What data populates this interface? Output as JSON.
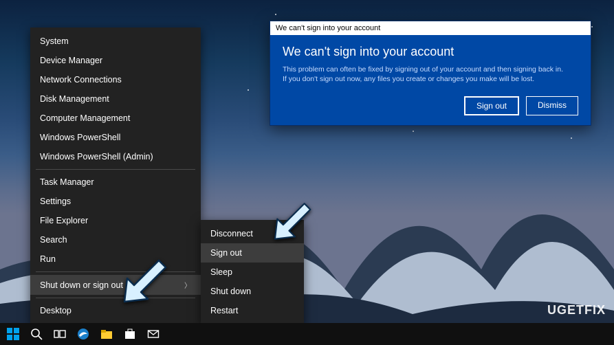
{
  "dialog": {
    "titlebar": "We can't sign into your account",
    "headline": "We can't sign into your account",
    "msg_line1": "This problem can often be fixed by signing out of your account and then signing back in.",
    "msg_line2": "If you don't sign out now, any files you create or changes you make will be lost.",
    "signout_label": "Sign out",
    "dismiss_label": "Dismiss"
  },
  "winx": {
    "items_group1": [
      "System",
      "Device Manager",
      "Network Connections",
      "Disk Management",
      "Computer Management",
      "Windows PowerShell",
      "Windows PowerShell (Admin)"
    ],
    "items_group2": [
      "Task Manager",
      "Settings",
      "File Explorer",
      "Search",
      "Run"
    ],
    "shutdown_label": "Shut down or sign out",
    "desktop_label": "Desktop"
  },
  "submenu": {
    "items": [
      "Disconnect",
      "Sign out",
      "Sleep",
      "Shut down",
      "Restart"
    ],
    "highlight_index": 1
  },
  "watermark": "UGETFIX"
}
